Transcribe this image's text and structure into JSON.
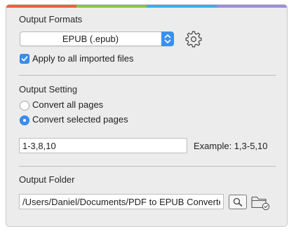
{
  "colors": {
    "stripe": [
      "#f25c3d",
      "#8bc441",
      "#35b0e3",
      "#9c8fd8"
    ],
    "accent": "#3a8ef3"
  },
  "output_formats": {
    "title": "Output Formats",
    "selected_format": "EPUB (.epub)",
    "apply_all_label": "Apply to all imported files",
    "apply_all_checked": true,
    "settings_icon": "gear-icon"
  },
  "output_setting": {
    "title": "Output Setting",
    "options": [
      {
        "label": "Convert all pages",
        "selected": false
      },
      {
        "label": "Convert selected pages",
        "selected": true
      }
    ],
    "pages_value": "1-3,8,10",
    "example_text": "Example: 1,3-5,10"
  },
  "output_folder": {
    "title": "Output Folder",
    "path_value": "/Users/Daniel/Documents/PDF to EPUB Converter",
    "search_icon": "magnifier-icon",
    "folder_icon": "folder-check-icon"
  }
}
